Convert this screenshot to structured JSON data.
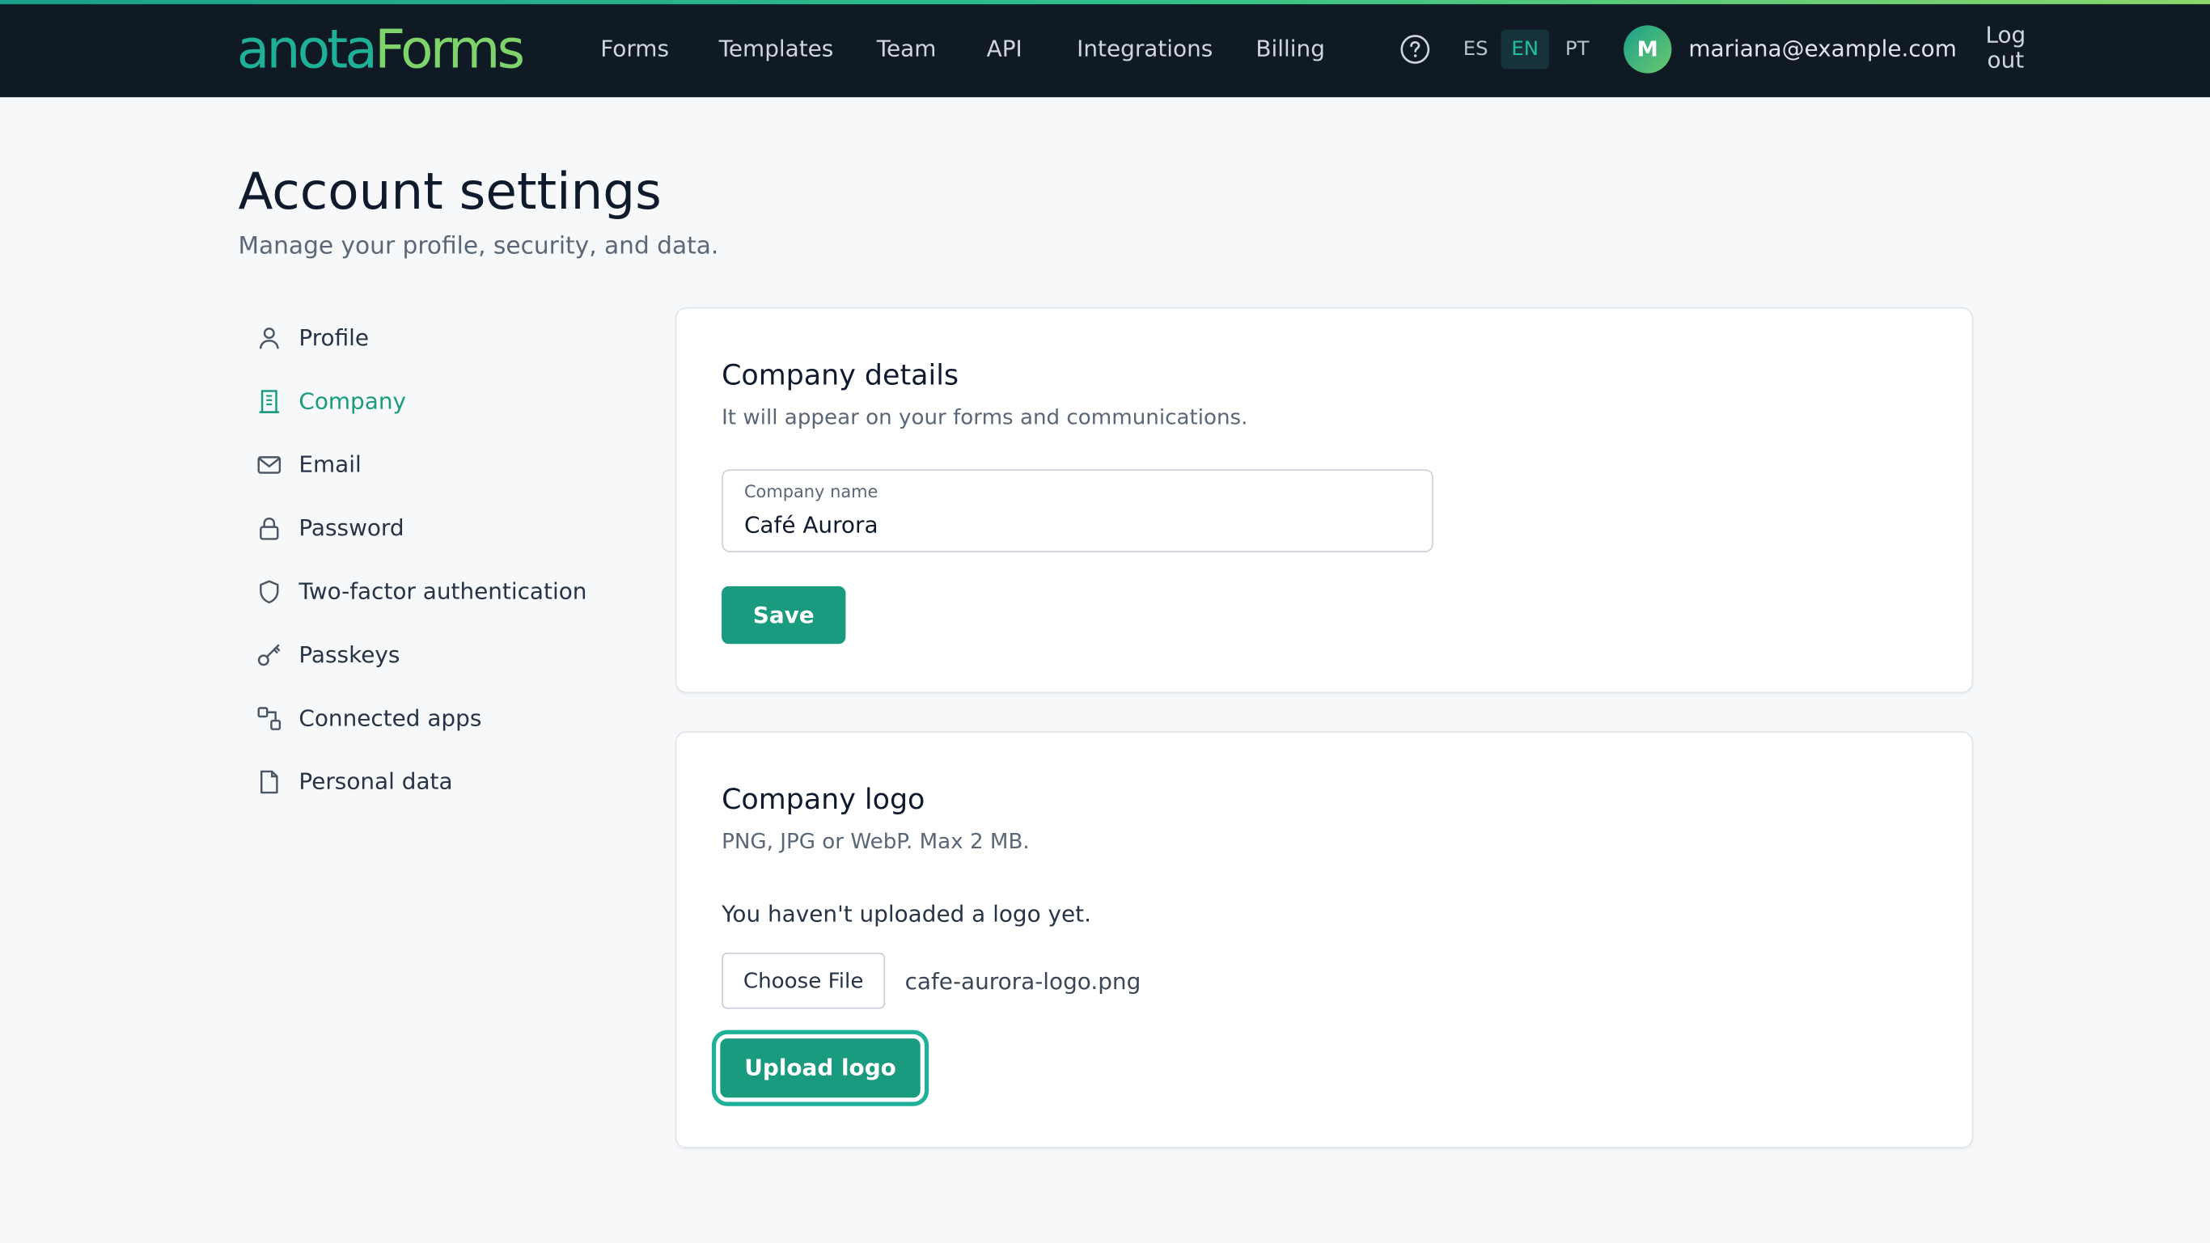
{
  "header": {
    "logo_part1": "anota",
    "logo_part2": "Forms",
    "nav": [
      "Forms",
      "Templates",
      "Team",
      "API",
      "Integrations",
      "Billing"
    ],
    "help_icon": "question-circle-icon",
    "languages": [
      "ES",
      "EN",
      "PT"
    ],
    "active_language": "EN",
    "avatar_initial": "M",
    "user_email": "mariana@example.com",
    "logout_label": "Log out"
  },
  "page": {
    "title": "Account settings",
    "subtitle": "Manage your profile, security, and data."
  },
  "sidebar": {
    "active": "Company",
    "items": [
      {
        "label": "Profile",
        "icon": "user-icon"
      },
      {
        "label": "Company",
        "icon": "building-icon"
      },
      {
        "label": "Email",
        "icon": "mail-icon"
      },
      {
        "label": "Password",
        "icon": "lock-icon"
      },
      {
        "label": "Two-factor authentication",
        "icon": "shield-icon"
      },
      {
        "label": "Passkeys",
        "icon": "key-icon"
      },
      {
        "label": "Connected apps",
        "icon": "connected-apps-icon"
      },
      {
        "label": "Personal data",
        "icon": "file-icon"
      }
    ]
  },
  "company_details": {
    "title": "Company details",
    "description": "It will appear on your forms and communications.",
    "field_label": "Company name",
    "field_value": "Café Aurora",
    "save_label": "Save"
  },
  "company_logo": {
    "title": "Company logo",
    "description": "PNG, JPG or WebP. Max 2 MB.",
    "status": "You haven't uploaded a logo yet.",
    "choose_file_label": "Choose File",
    "file_name": "cafe-aurora-logo.png",
    "upload_label": "Upload logo"
  },
  "colors": {
    "topbar_bg": "#0f1a25",
    "accent": "#1a9b7f",
    "active_lang_bg": "#16323a"
  }
}
